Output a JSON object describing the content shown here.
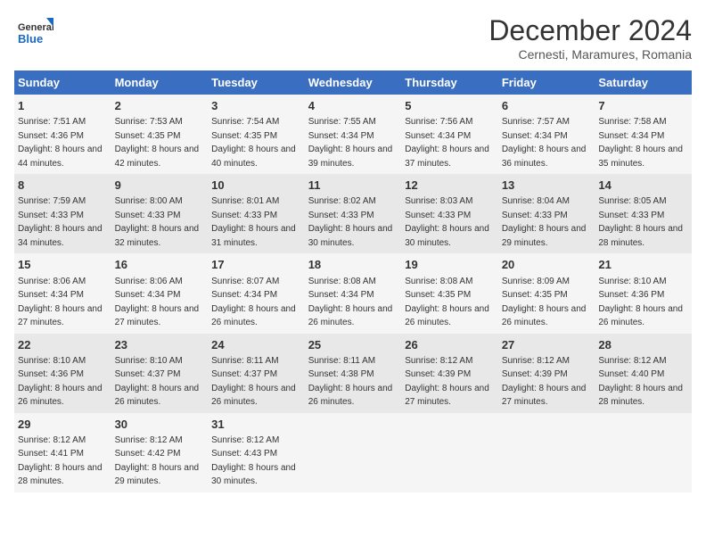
{
  "logo": {
    "general": "General",
    "blue": "Blue"
  },
  "header": {
    "title": "December 2024",
    "subtitle": "Cernesti, Maramures, Romania"
  },
  "weekdays": [
    "Sunday",
    "Monday",
    "Tuesday",
    "Wednesday",
    "Thursday",
    "Friday",
    "Saturday"
  ],
  "weeks": [
    [
      {
        "day": "1",
        "sunrise": "7:51 AM",
        "sunset": "4:36 PM",
        "daylight": "8 hours and 44 minutes."
      },
      {
        "day": "2",
        "sunrise": "7:53 AM",
        "sunset": "4:35 PM",
        "daylight": "8 hours and 42 minutes."
      },
      {
        "day": "3",
        "sunrise": "7:54 AM",
        "sunset": "4:35 PM",
        "daylight": "8 hours and 40 minutes."
      },
      {
        "day": "4",
        "sunrise": "7:55 AM",
        "sunset": "4:34 PM",
        "daylight": "8 hours and 39 minutes."
      },
      {
        "day": "5",
        "sunrise": "7:56 AM",
        "sunset": "4:34 PM",
        "daylight": "8 hours and 37 minutes."
      },
      {
        "day": "6",
        "sunrise": "7:57 AM",
        "sunset": "4:34 PM",
        "daylight": "8 hours and 36 minutes."
      },
      {
        "day": "7",
        "sunrise": "7:58 AM",
        "sunset": "4:34 PM",
        "daylight": "8 hours and 35 minutes."
      }
    ],
    [
      {
        "day": "8",
        "sunrise": "7:59 AM",
        "sunset": "4:33 PM",
        "daylight": "8 hours and 34 minutes."
      },
      {
        "day": "9",
        "sunrise": "8:00 AM",
        "sunset": "4:33 PM",
        "daylight": "8 hours and 32 minutes."
      },
      {
        "day": "10",
        "sunrise": "8:01 AM",
        "sunset": "4:33 PM",
        "daylight": "8 hours and 31 minutes."
      },
      {
        "day": "11",
        "sunrise": "8:02 AM",
        "sunset": "4:33 PM",
        "daylight": "8 hours and 30 minutes."
      },
      {
        "day": "12",
        "sunrise": "8:03 AM",
        "sunset": "4:33 PM",
        "daylight": "8 hours and 30 minutes."
      },
      {
        "day": "13",
        "sunrise": "8:04 AM",
        "sunset": "4:33 PM",
        "daylight": "8 hours and 29 minutes."
      },
      {
        "day": "14",
        "sunrise": "8:05 AM",
        "sunset": "4:33 PM",
        "daylight": "8 hours and 28 minutes."
      }
    ],
    [
      {
        "day": "15",
        "sunrise": "8:06 AM",
        "sunset": "4:34 PM",
        "daylight": "8 hours and 27 minutes."
      },
      {
        "day": "16",
        "sunrise": "8:06 AM",
        "sunset": "4:34 PM",
        "daylight": "8 hours and 27 minutes."
      },
      {
        "day": "17",
        "sunrise": "8:07 AM",
        "sunset": "4:34 PM",
        "daylight": "8 hours and 26 minutes."
      },
      {
        "day": "18",
        "sunrise": "8:08 AM",
        "sunset": "4:34 PM",
        "daylight": "8 hours and 26 minutes."
      },
      {
        "day": "19",
        "sunrise": "8:08 AM",
        "sunset": "4:35 PM",
        "daylight": "8 hours and 26 minutes."
      },
      {
        "day": "20",
        "sunrise": "8:09 AM",
        "sunset": "4:35 PM",
        "daylight": "8 hours and 26 minutes."
      },
      {
        "day": "21",
        "sunrise": "8:10 AM",
        "sunset": "4:36 PM",
        "daylight": "8 hours and 26 minutes."
      }
    ],
    [
      {
        "day": "22",
        "sunrise": "8:10 AM",
        "sunset": "4:36 PM",
        "daylight": "8 hours and 26 minutes."
      },
      {
        "day": "23",
        "sunrise": "8:10 AM",
        "sunset": "4:37 PM",
        "daylight": "8 hours and 26 minutes."
      },
      {
        "day": "24",
        "sunrise": "8:11 AM",
        "sunset": "4:37 PM",
        "daylight": "8 hours and 26 minutes."
      },
      {
        "day": "25",
        "sunrise": "8:11 AM",
        "sunset": "4:38 PM",
        "daylight": "8 hours and 26 minutes."
      },
      {
        "day": "26",
        "sunrise": "8:12 AM",
        "sunset": "4:39 PM",
        "daylight": "8 hours and 27 minutes."
      },
      {
        "day": "27",
        "sunrise": "8:12 AM",
        "sunset": "4:39 PM",
        "daylight": "8 hours and 27 minutes."
      },
      {
        "day": "28",
        "sunrise": "8:12 AM",
        "sunset": "4:40 PM",
        "daylight": "8 hours and 28 minutes."
      }
    ],
    [
      {
        "day": "29",
        "sunrise": "8:12 AM",
        "sunset": "4:41 PM",
        "daylight": "8 hours and 28 minutes."
      },
      {
        "day": "30",
        "sunrise": "8:12 AM",
        "sunset": "4:42 PM",
        "daylight": "8 hours and 29 minutes."
      },
      {
        "day": "31",
        "sunrise": "8:12 AM",
        "sunset": "4:43 PM",
        "daylight": "8 hours and 30 minutes."
      },
      null,
      null,
      null,
      null
    ]
  ],
  "labels": {
    "sunrise": "Sunrise:",
    "sunset": "Sunset:",
    "daylight": "Daylight:"
  }
}
